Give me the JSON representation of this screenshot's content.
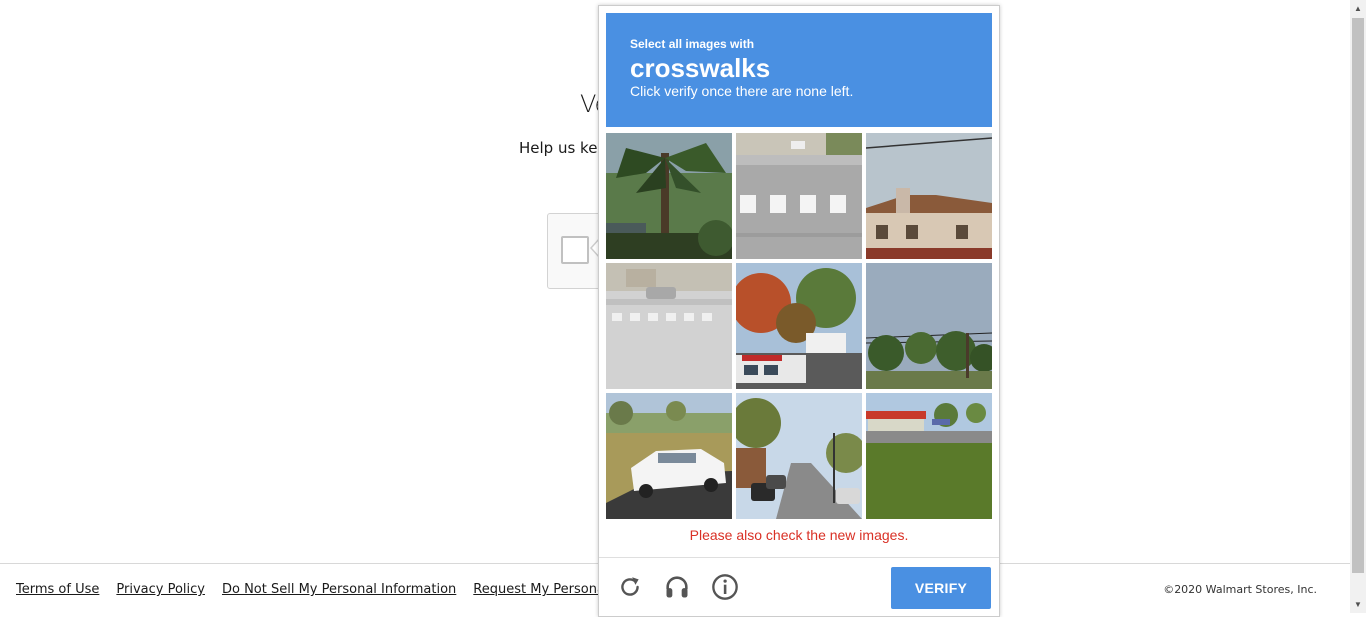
{
  "page": {
    "heading": "Ve",
    "subheading": "Help us kee"
  },
  "footer": {
    "links": [
      "Terms of Use",
      "Privacy Policy",
      "Do Not Sell My Personal Information",
      "Request My Personal In"
    ],
    "copyright": "©2020 Walmart Stores, Inc."
  },
  "captcha": {
    "instruction_line1": "Select all images with",
    "keyword": "crosswalks",
    "instruction_line3": "Click verify once there are none left.",
    "tiles": [
      "palm-trees",
      "crosswalk-street",
      "house-rooftop",
      "crosswalk-faded",
      "autumn-trees-bus",
      "trees-power-lines",
      "white-car-park",
      "street-traffic-light",
      "gas-station-road"
    ],
    "error_message": "Please also check the new images.",
    "verify_label": "VERIFY",
    "controls": [
      "reload-icon",
      "audio-icon",
      "info-icon"
    ],
    "accent_color": "#4a90e2",
    "error_color": "#d93025"
  }
}
